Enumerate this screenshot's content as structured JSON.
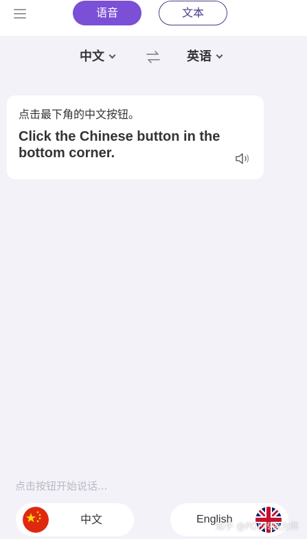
{
  "header": {
    "tabs": [
      {
        "label": "语音",
        "active": true
      },
      {
        "label": "文本",
        "active": false
      }
    ]
  },
  "language_bar": {
    "source_language": "中文",
    "target_language": "英语"
  },
  "result_card": {
    "source_text": "点击最下角的中文按钮。",
    "translated_text": "Click the Chinese button in the bottom corner."
  },
  "hint_text": "点击按钮开始说话...",
  "bottom_buttons": {
    "chinese_label": "中文",
    "english_label": "English"
  },
  "watermark": "知乎 @PDF转换大师",
  "colors": {
    "accent": "#7b4fd6",
    "tab_outline": "#4a3a8a",
    "background": "#f3f2f9",
    "hint": "#b9b9c4"
  },
  "icons": {
    "menu": "hamburger-icon",
    "swap": "swap-arrows-icon",
    "speaker": "speaker-icon",
    "china_flag": "china-flag-icon",
    "uk_flag": "uk-flag-icon"
  }
}
